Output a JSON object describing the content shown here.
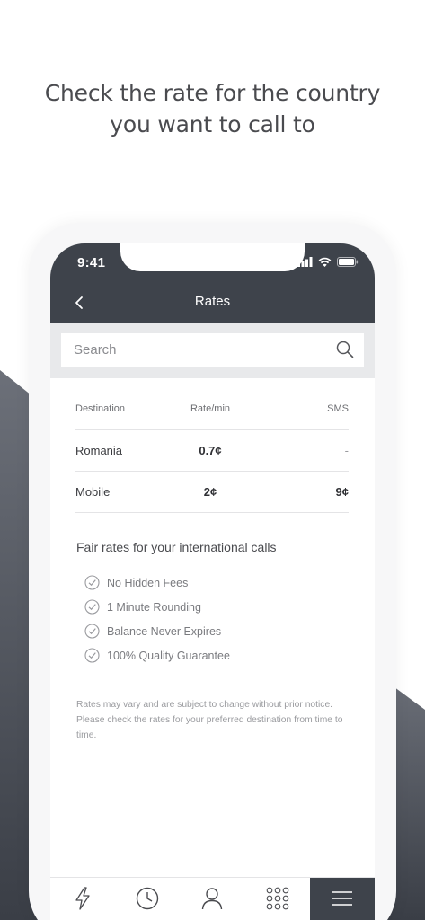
{
  "headline": {
    "line1": "Check the rate for the country",
    "line2": "you want to call to"
  },
  "status_bar": {
    "time": "9:41"
  },
  "nav": {
    "title": "Rates",
    "back_icon": "chevron-left-icon"
  },
  "search": {
    "placeholder": "Search",
    "icon": "search-icon"
  },
  "rates_table": {
    "headers": [
      "Destination",
      "Rate/min",
      "SMS"
    ],
    "rows": [
      {
        "destination": "Romania",
        "rate": "0.7¢",
        "sms": "-"
      },
      {
        "destination": "Mobile",
        "rate": "2¢",
        "sms": "9¢"
      }
    ]
  },
  "fair_rates": {
    "title": "Fair rates for your international calls",
    "features": [
      "No Hidden Fees",
      "1 Minute Rounding",
      "Balance Never Expires",
      "100% Quality Guarantee"
    ]
  },
  "disclaimer": "Rates may vary and are subject to change without prior notice. Please check the rates for your preferred destination from time to time.",
  "tabbar": {
    "tabs": [
      "lightning-icon",
      "clock-icon",
      "person-icon",
      "keypad-icon",
      "menu-icon"
    ],
    "active": "menu-icon"
  },
  "colors": {
    "dark": "#3e434b",
    "search_bg": "#e8e9eb",
    "headline": "#4a4b4f"
  }
}
